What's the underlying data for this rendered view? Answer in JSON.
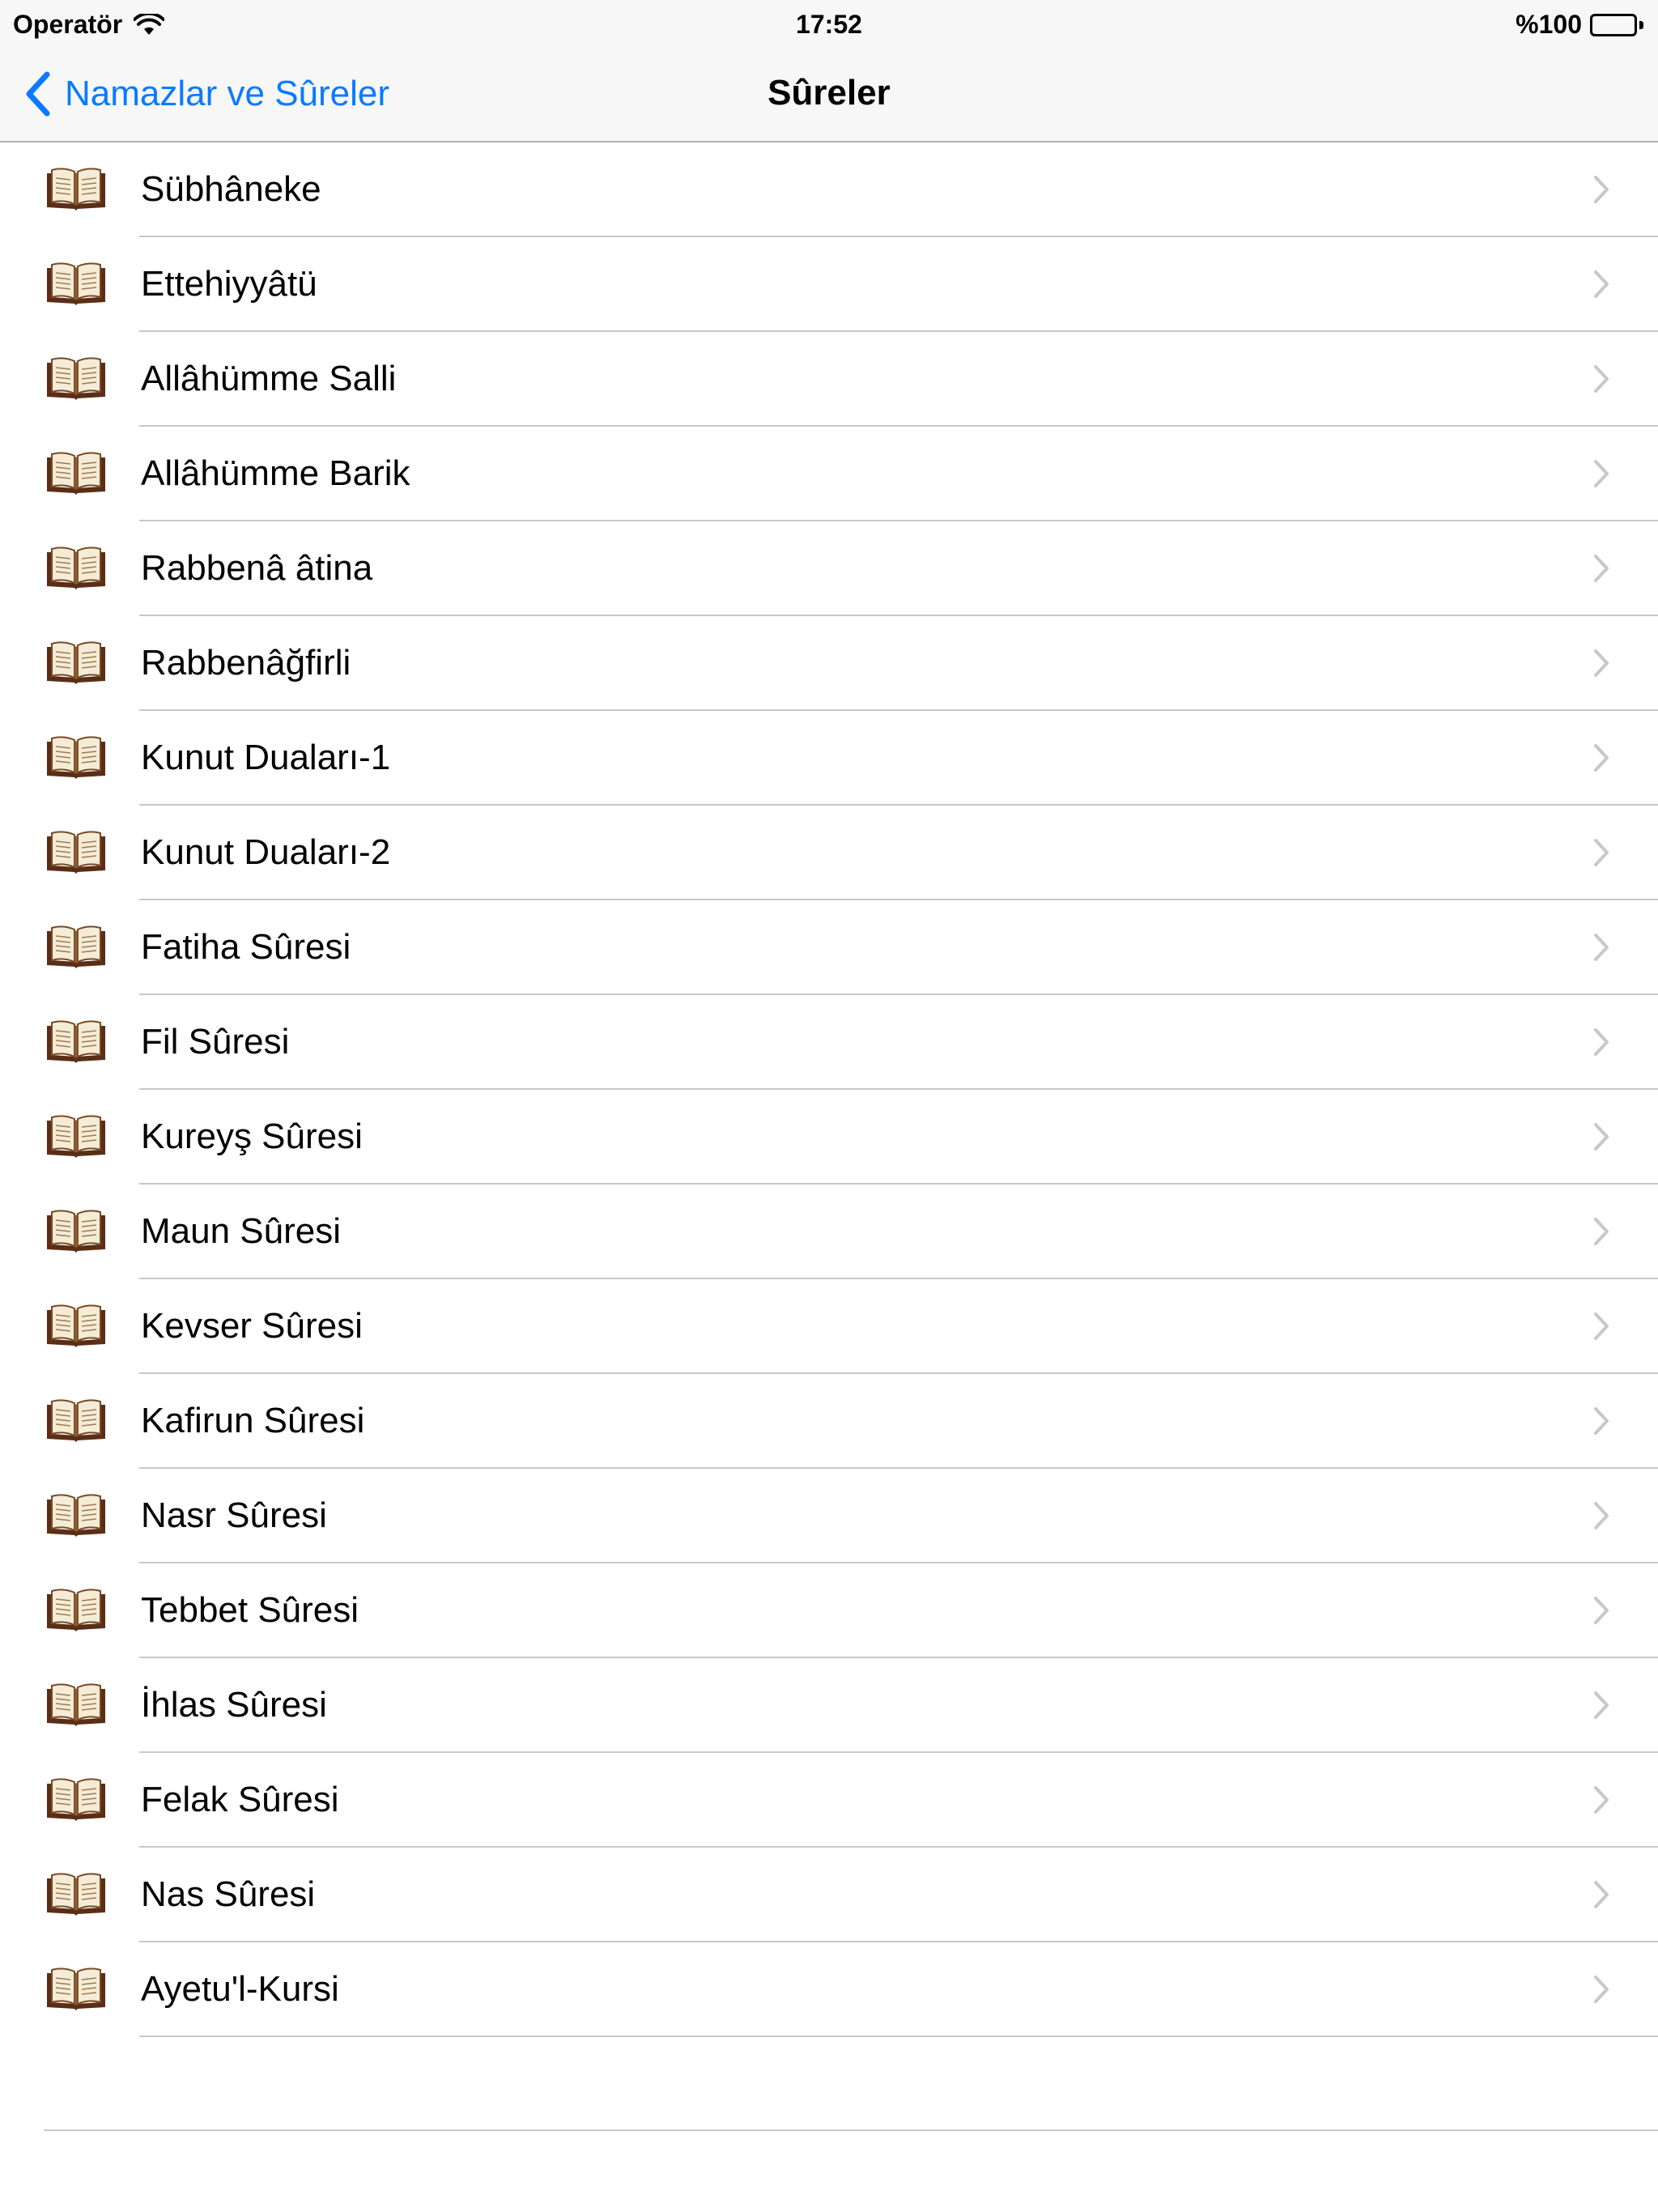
{
  "status_bar": {
    "carrier": "Operatör",
    "carrier_icon": "wifi-icon",
    "time": "17:52",
    "battery_text": "%100",
    "battery_icon": "battery-full-icon",
    "battery_level": 1.0
  },
  "nav": {
    "back_label": "Namazlar ve Sûreler",
    "back_icon": "chevron-left-icon",
    "title": "Sûreler",
    "accent_color": "#0a7aff"
  },
  "list": {
    "item_icon": "open-book-icon",
    "accessory_icon": "chevron-right-icon",
    "items": [
      {
        "label": "Sübhâneke"
      },
      {
        "label": "Ettehiyyâtü"
      },
      {
        "label": "Allâhümme Salli"
      },
      {
        "label": "Allâhümme Barik"
      },
      {
        "label": "Rabbenâ âtina"
      },
      {
        "label": "Rabbenâğfirli"
      },
      {
        "label": "Kunut Duaları-1"
      },
      {
        "label": "Kunut Duaları-2"
      },
      {
        "label": "Fatiha Sûresi"
      },
      {
        "label": "Fil Sûresi"
      },
      {
        "label": "Kureyş Sûresi"
      },
      {
        "label": "Maun Sûresi"
      },
      {
        "label": "Kevser Sûresi"
      },
      {
        "label": "Kafirun Sûresi"
      },
      {
        "label": "Nasr Sûresi"
      },
      {
        "label": "Tebbet Sûresi"
      },
      {
        "label": "İhlas Sûresi"
      },
      {
        "label": "Felak Sûresi"
      },
      {
        "label": "Nas Sûresi"
      },
      {
        "label": "Ayetu'l-Kursi"
      }
    ]
  }
}
